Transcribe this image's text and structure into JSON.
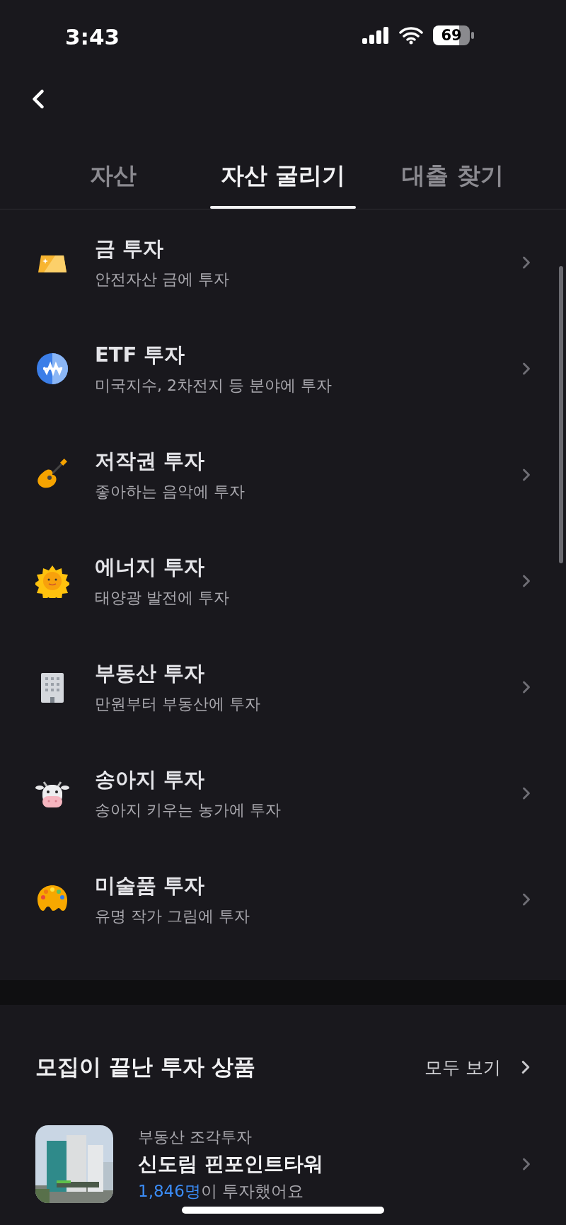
{
  "status_bar": {
    "time": "3:43",
    "battery": "69"
  },
  "tabs": [
    {
      "label": "자산",
      "selected": false
    },
    {
      "label": "자산 굴리기",
      "selected": true
    },
    {
      "label": "대출 찾기",
      "selected": false
    }
  ],
  "investments": [
    {
      "title": "금 투자",
      "subtitle": "안전자산 금에 투자"
    },
    {
      "title": "ETF 투자",
      "subtitle": "미국지수, 2차전지 등 분야에 투자"
    },
    {
      "title": "저작권 투자",
      "subtitle": "좋아하는 음악에 투자"
    },
    {
      "title": "에너지 투자",
      "subtitle": "태양광 발전에 투자"
    },
    {
      "title": "부동산 투자",
      "subtitle": "만원부터 부동산에 투자"
    },
    {
      "title": "송아지 투자",
      "subtitle": "송아지 키우는 농가에 투자"
    },
    {
      "title": "미술품 투자",
      "subtitle": "유명 작가 그림에 투자"
    }
  ],
  "closed_section": {
    "title": "모집이 끝난 투자 상품",
    "see_all": "모두 보기",
    "products": [
      {
        "kind": "picture",
        "category": "부동산 조각투자",
        "name": "신도림 핀포인트타워",
        "count": "1,846명",
        "count_suffix": "이 투자했어요"
      }
    ]
  }
}
